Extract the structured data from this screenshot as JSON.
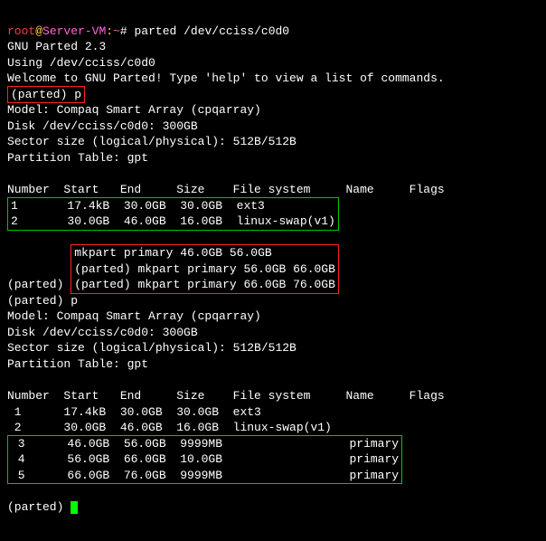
{
  "prompt": {
    "user": "root",
    "at": "@",
    "host": "Server-VM",
    "colon": ":",
    "tilde": "~",
    "hash": "# ",
    "cmd": "parted /dev/cciss/c0d0"
  },
  "intro": {
    "l1": "GNU Parted 2.3",
    "l2": "Using /dev/cciss/c0d0",
    "l3": "Welcome to GNU Parted! Type 'help' to view a list of commands."
  },
  "parted_prompt": "(parted)",
  "cmd_p": "p",
  "info": {
    "model": "Model: Compaq Smart Array (cpqarray)",
    "disk": "Disk /dev/cciss/c0d0: 300GB",
    "sector": "Sector size (logical/physical): 512B/512B",
    "ptable": "Partition Table: gpt"
  },
  "hdr": "Number  Start   End     Size    File system     Name     Flags",
  "tbl1": {
    "r1": "1       17.4kB  30.0GB  30.0GB  ext3",
    "r2": "2       30.0GB  46.0GB  16.0GB  linux-swap(v1)"
  },
  "mk": {
    "c1": "mkpart primary 46.0GB 56.0GB",
    "c2": "mkpart primary 56.0GB 66.0GB",
    "c3": "mkpart primary 66.0GB 76.0GB"
  },
  "cmd_p2": "p",
  "hdr2": "Number  Start   End     Size    File system     Name     Flags",
  "tbl2": {
    "r1": " 1      17.4kB  30.0GB  30.0GB  ext3",
    "r2": " 2      30.0GB  46.0GB  16.0GB  linux-swap(v1)",
    "r3": " 3      46.0GB  56.0GB  9999MB                  primary",
    "r4": " 4      56.0GB  66.0GB  10.0GB                  primary",
    "r5": " 5      66.0GB  76.0GB  9999MB                  primary"
  }
}
